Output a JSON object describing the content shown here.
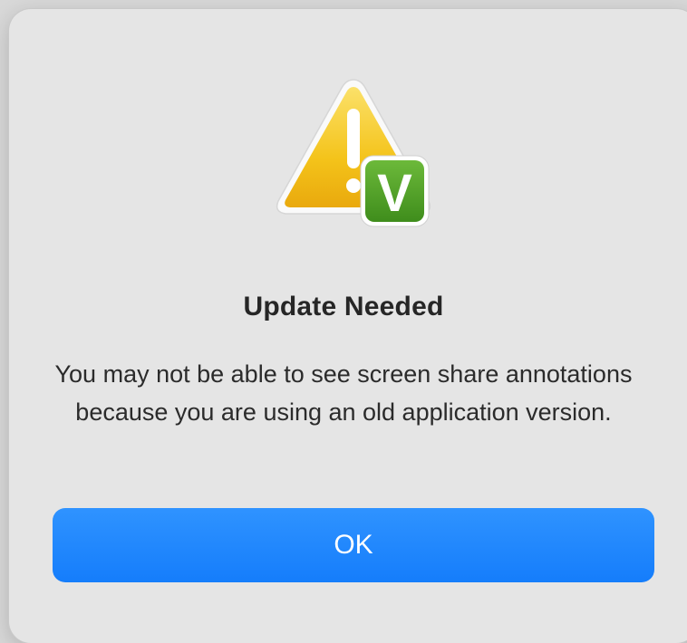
{
  "dialog": {
    "title": "Update Needed",
    "message": "You may not be able to see screen share annotations because you are using an old application version.",
    "ok_label": "OK",
    "badge_letter": "V",
    "icon": "warning-triangle-icon",
    "badge_icon": "app-badge-icon"
  },
  "colors": {
    "accent": "#1a84fc",
    "warning": "#f5c518",
    "badge": "#54a126"
  }
}
